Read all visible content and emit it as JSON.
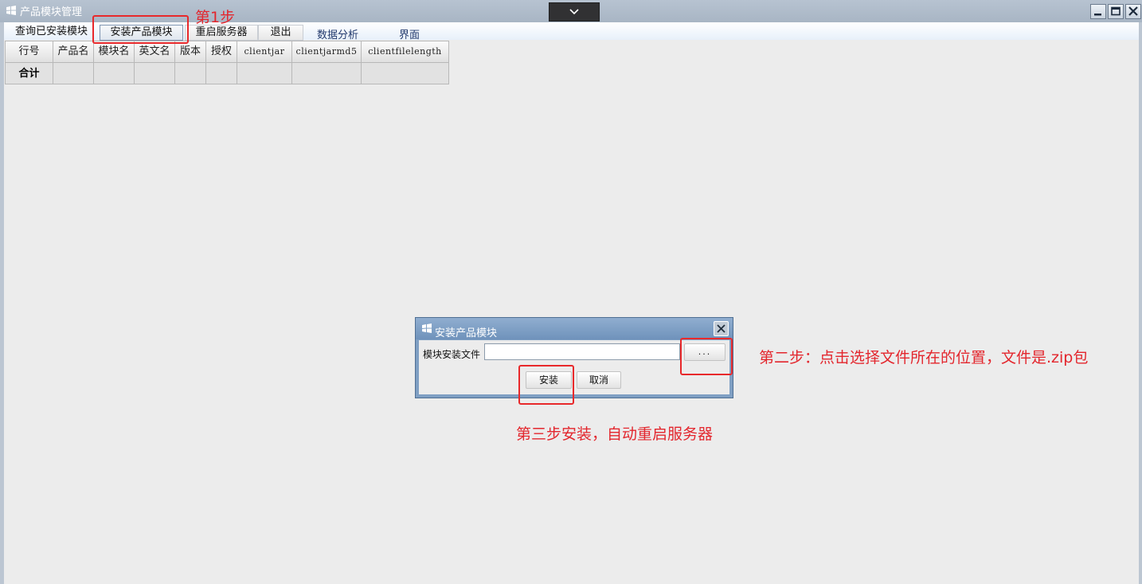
{
  "window": {
    "title": "产品模块管理"
  },
  "menu": {
    "query_label": "查询已安装模块",
    "install_label": "安装产品模块",
    "restart_label": "重启服务器",
    "exit_label": "退出",
    "analysis_label": "数据分析",
    "ui_label": "界面"
  },
  "table": {
    "columns": [
      "行号",
      "产品名",
      "模块名",
      "英文名",
      "版本",
      "授权",
      "clientjar",
      "clientjarmd5",
      "clientfilelength"
    ],
    "total_label": "合计"
  },
  "dialog": {
    "title": "安装产品模块",
    "file_label": "模块安装文件",
    "file_value": "",
    "browse_label": "...",
    "install_label": "安装",
    "cancel_label": "取消"
  },
  "annotations": {
    "step1": "第1步",
    "step2": "第二步：点击选择文件所在的位置，文件是.zip包",
    "step3": "第三步安装，自动重启服务器"
  },
  "colors": {
    "annotation": "#e3262d",
    "titlebar": "#a8b5c4",
    "dialog_titlebar": "#7f9fc3"
  }
}
